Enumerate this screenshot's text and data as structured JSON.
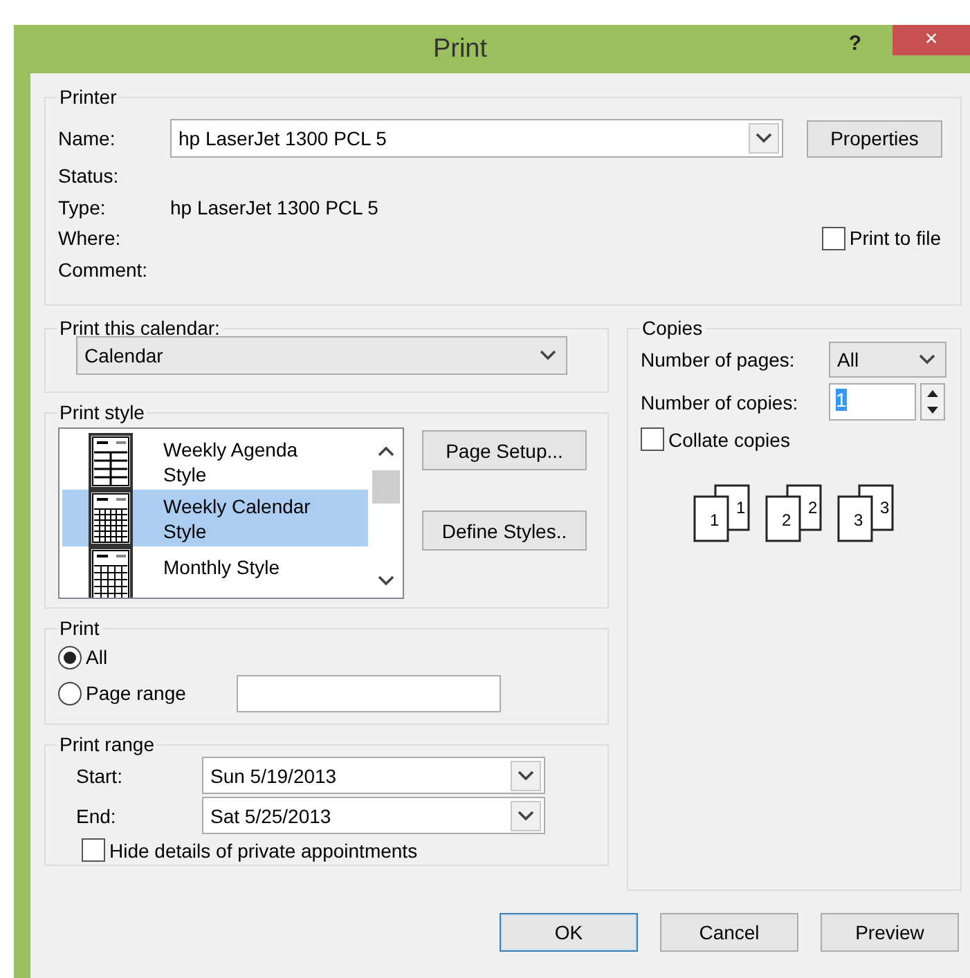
{
  "window": {
    "title": "Print",
    "help": "?",
    "close": "×"
  },
  "printer": {
    "title": "Printer",
    "name_label": "Name:",
    "name_value": "hp LaserJet 1300 PCL 5",
    "properties_button": "Properties",
    "fields": [
      {
        "label": "Status:"
      },
      {
        "label": "Type:",
        "value": "hp LaserJet 1300 PCL 5"
      },
      {
        "label": "Where:"
      },
      {
        "label": "Comment:"
      }
    ],
    "print_to_file": {
      "label": "Print to file",
      "checked": false
    }
  },
  "print_this_calendar": {
    "title": "Print this calendar:",
    "value": "Calendar"
  },
  "print_style": {
    "title": "Print style",
    "items": [
      {
        "label": "Weekly Agenda Style",
        "kind": "agenda",
        "selected": false
      },
      {
        "label": "Weekly Calendar Style",
        "kind": "weekly",
        "selected": true
      },
      {
        "label": "Monthly Style",
        "kind": "monthly",
        "selected": false
      }
    ],
    "buttons": [
      "Page Setup...",
      "Define Styles.."
    ]
  },
  "print": {
    "title": "Print",
    "options": [
      {
        "label": "All",
        "selected": true
      },
      {
        "label": "Page range",
        "selected": false
      }
    ]
  },
  "print_range": {
    "title": "Print range",
    "start_label": "Start:",
    "start_value": "Sun 5/19/2013",
    "end_label": "End:",
    "end_value": "Sat 5/25/2013",
    "hide_private": {
      "label": "Hide details of private appointments",
      "checked": false
    }
  },
  "copies": {
    "title": "Copies",
    "pages_label": "Number of pages:",
    "pages_value": "All",
    "copies_label": "Number of copies:",
    "copies_value": "1",
    "collate": {
      "label": "Collate copies",
      "checked": false
    },
    "stacks": [
      {
        "front": "1",
        "back": "1"
      },
      {
        "front": "2",
        "back": "2"
      },
      {
        "front": "3",
        "back": "3"
      }
    ]
  },
  "buttons": [
    {
      "label": "OK",
      "default": true
    },
    {
      "label": "Cancel",
      "default": false
    },
    {
      "label": "Preview",
      "default": false
    }
  ]
}
